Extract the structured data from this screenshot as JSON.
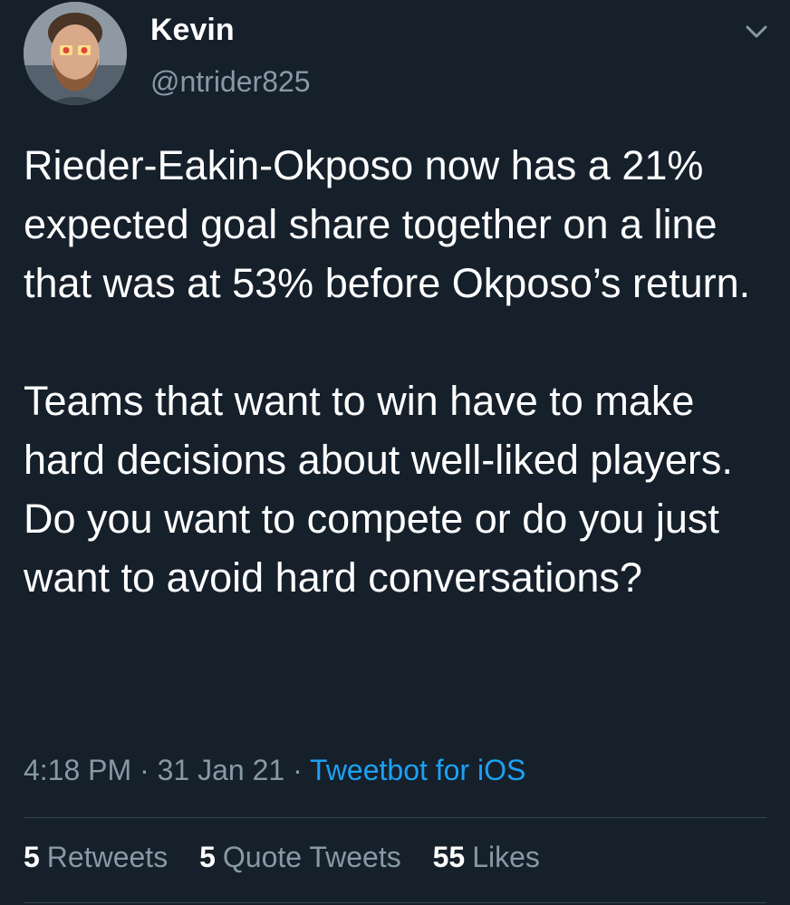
{
  "author": {
    "display_name": "Kevin",
    "handle": "@ntrider825"
  },
  "tweet": {
    "paragraphs": [
      "Rieder-Eakin-Okposo now has a 21% expected goal share together on a line that was at 53% before Okposo’s return.",
      "Teams that want to win have to make hard decisions about well-liked players. Do you want to compete or do you just want to avoid hard conversations?"
    ]
  },
  "meta": {
    "time": "4:18 PM",
    "separator1": " · ",
    "date": "31 Jan 21",
    "separator2": " · ",
    "source": "Tweetbot for iOS"
  },
  "stats": {
    "retweets_count": "5",
    "retweets_label": "Retweets",
    "quote_count": "5",
    "quote_label": "Quote Tweets",
    "likes_count": "55",
    "likes_label": "Likes"
  },
  "icons": {
    "caret": "chevron-down-icon",
    "avatar": "avatar"
  },
  "colors": {
    "background": "#15202b",
    "text_primary": "#ffffff",
    "text_secondary": "#8899a6",
    "link": "#1da1f2",
    "divider": "#38444d"
  }
}
